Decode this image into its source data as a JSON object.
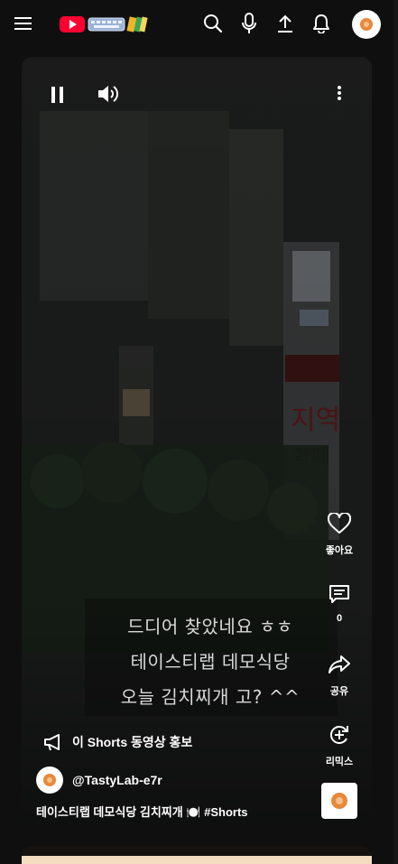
{
  "topbar": {
    "menu_icon": "hamburger-icon",
    "logo_icons": [
      "youtube-play-icon",
      "keyboard-icon",
      "pencil-icon"
    ],
    "search_icon": "search-icon",
    "mic_icon": "microphone-icon",
    "upload_icon": "upload-icon",
    "notifications_icon": "bell-icon",
    "avatar_icon": "avatar-icon"
  },
  "player": {
    "pause_icon": "pause-icon",
    "volume_icon": "volume-icon",
    "more_icon": "more-vertical-icon",
    "caption_lines": [
      "드디어 찾았네요 ㅎㅎ",
      "테이스티랩 데모식당",
      "오늘 김치찌개 고? ^^"
    ],
    "actions": {
      "like": {
        "icon": "heart-icon",
        "label": "좋아요"
      },
      "comment": {
        "icon": "comment-icon",
        "label": "0"
      },
      "share": {
        "icon": "share-icon",
        "label": "공유"
      },
      "remix": {
        "icon": "remix-icon",
        "label": "리믹스"
      }
    },
    "promo_text": "이 Shorts 동영상 홍보",
    "promo_icon": "megaphone-icon",
    "channel_name": "@TastyLab-e7r",
    "video_title": "테이스티랩 데모식당 김치찌개 🍽️ ",
    "hashtag": "#Shorts",
    "sound_thumb_icon": "sound-thumbnail-icon"
  },
  "colors": {
    "background": "#0f0f0f",
    "youtube_red": "#ff0033",
    "text": "#ffffff",
    "avatar_orange": "#e8883a"
  }
}
